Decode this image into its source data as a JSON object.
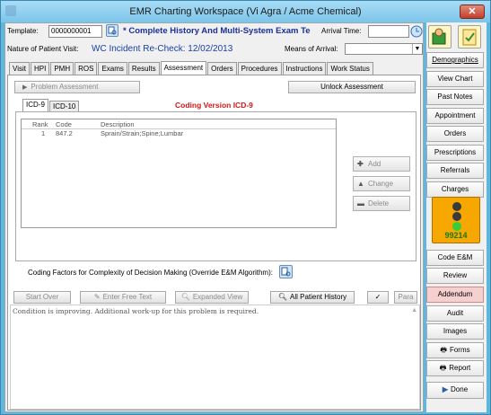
{
  "window": {
    "title": "EMR Charting Workspace (Vi Agra / Acme Chemical)",
    "close_glyph": "✕"
  },
  "header": {
    "template_label": "Template:",
    "template_value": "0000000001",
    "template_name": "* Complete History And Multi-System Exam Te",
    "arrival_time_label": "Arrival Time:",
    "arrival_time_value": "",
    "nature_label": "Nature of Patient Visit:",
    "nature_value": "WC Incident Re-Check: 12/02/2013",
    "means_label": "Means of Arrival:",
    "means_value": ""
  },
  "tabs": [
    "Visit",
    "HPI",
    "PMH",
    "ROS",
    "Exams",
    "Results",
    "Assessment",
    "Orders",
    "Procedures",
    "Instructions",
    "Work Status"
  ],
  "active_tab": "Assessment",
  "assessment": {
    "problem_assessment_label": "Problem Assessment",
    "unlock_label": "Unlock Assessment",
    "icd9_tab": "ICD-9",
    "icd10_tab": "ICD-10",
    "coding_version": "Coding Version ICD-9",
    "columns": [
      "Rank",
      "Code",
      "Description"
    ],
    "rows": [
      {
        "rank": "1",
        "code": "847.2",
        "description": "Sprain/Strain;Spine;Lumbar"
      }
    ],
    "add_label": "Add",
    "change_label": "Change",
    "delete_label": "Delete",
    "coding_factors_label": "Coding Factors for Complexity of Decision Making (Override E&M Algorithm):"
  },
  "toolbar": {
    "start_over": "Start Over",
    "enter_free_text": "Enter Free Text",
    "expanded_view": "Expanded View",
    "all_patient_history": "All Patient History",
    "para": "Para"
  },
  "notes": {
    "text": "Condition is improving. Additional work-up for this problem is required."
  },
  "right_panel": {
    "demographics": "Demographics",
    "view_chart": "View Chart",
    "past_notes": "Past Notes",
    "appointment": "Appointment",
    "orders": "Orders",
    "prescriptions": "Prescriptions",
    "referrals": "Referrals",
    "charges": "Charges",
    "em_code": "99214",
    "code_em": "Code E&M",
    "review": "Review",
    "addendum": "Addendum",
    "audit": "Audit",
    "images": "Images",
    "forms": "Forms",
    "report": "Report",
    "done": "Done"
  }
}
